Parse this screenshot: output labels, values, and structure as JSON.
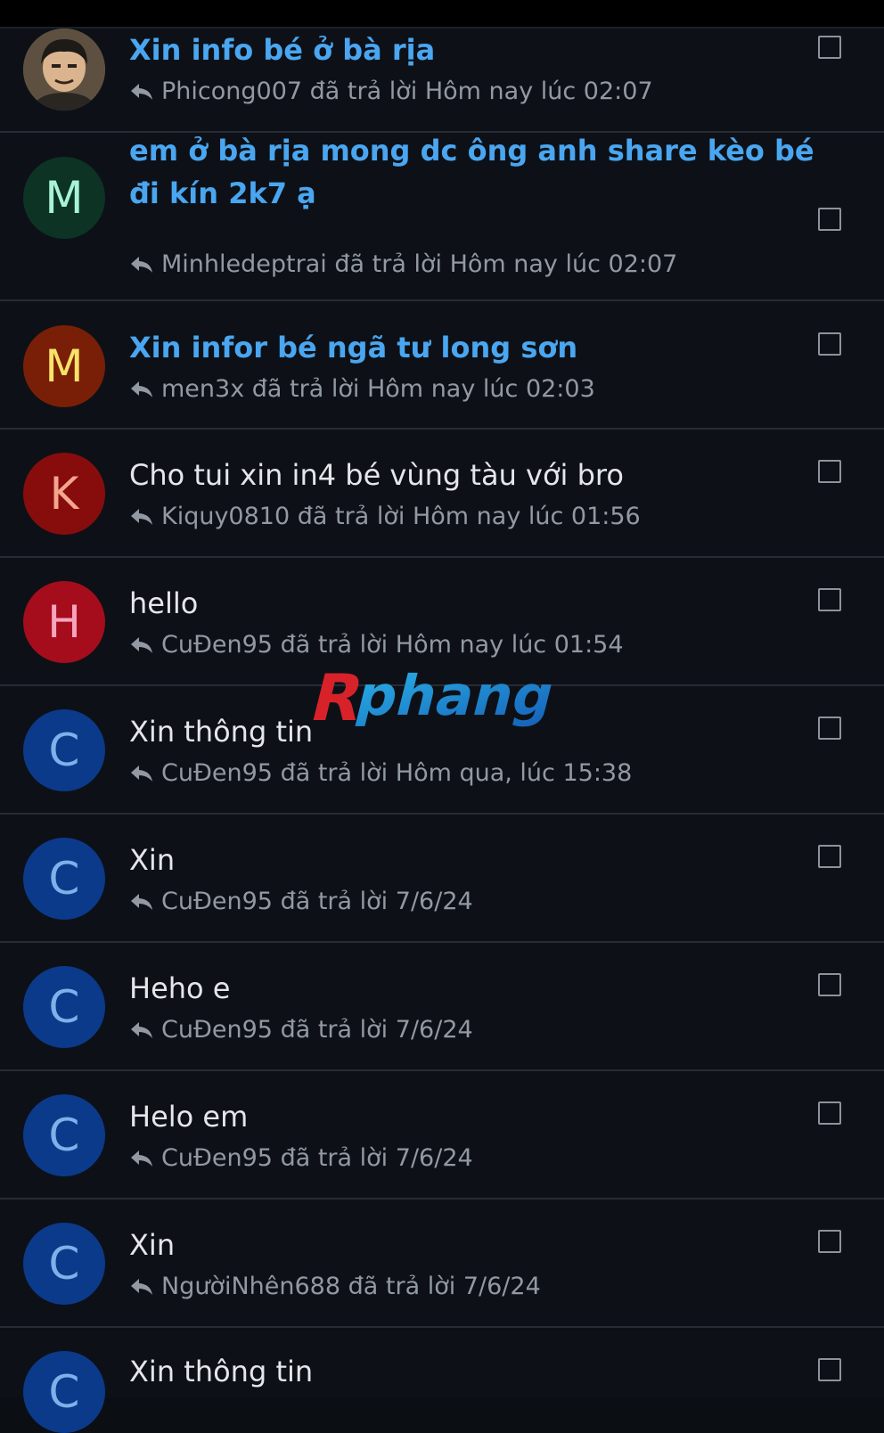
{
  "watermark": {
    "text_a": "R",
    "text_b": "phang"
  },
  "conversations": [
    {
      "title": "Xin info bé ở bà rịa",
      "unread": true,
      "avatar": {
        "type": "image",
        "letter": "",
        "bg": "#6b5a45",
        "fg": ""
      },
      "reply_user": "Phicong007",
      "reply_text": "đã trả lời",
      "reply_time": "Hôm nay lúc 02:07"
    },
    {
      "title": "em ở bà rịa mong dc ông anh share kèo bé đi kín 2k7 ạ",
      "unread": true,
      "avatar": {
        "type": "letter",
        "letter": "M",
        "bg": "#0d3324",
        "fg": "#a8f3d6"
      },
      "reply_user": "Minhledeptrai",
      "reply_text": "đã trả lời",
      "reply_time": "Hôm nay lúc 02:07"
    },
    {
      "title": "Xin infor bé ngã tư long sơn",
      "unread": true,
      "avatar": {
        "type": "letter",
        "letter": "M",
        "bg": "#7a1f07",
        "fg": "#f7e36a"
      },
      "reply_user": "men3x",
      "reply_text": "đã trả lời",
      "reply_time": "Hôm nay lúc 02:03"
    },
    {
      "title": "Cho tui xin in4 bé vùng tàu với bro",
      "unread": false,
      "avatar": {
        "type": "letter",
        "letter": "K",
        "bg": "#870d0d",
        "fg": "#f4a58e"
      },
      "reply_user": "Kiquy0810",
      "reply_text": "đã trả lời",
      "reply_time": "Hôm nay lúc 01:56"
    },
    {
      "title": "hello",
      "unread": false,
      "avatar": {
        "type": "letter",
        "letter": "H",
        "bg": "#a50d1c",
        "fg": "#f7a4bf"
      },
      "reply_user": "CuĐen95",
      "reply_text": "đã trả lời",
      "reply_time": "Hôm nay lúc 01:54"
    },
    {
      "title": "Xin thông tin",
      "unread": false,
      "avatar": {
        "type": "letter",
        "letter": "C",
        "bg": "#0b3a8a",
        "fg": "#7fb0ea"
      },
      "reply_user": "CuĐen95",
      "reply_text": "đã trả lời",
      "reply_time": "Hôm qua, lúc 15:38"
    },
    {
      "title": "Xin",
      "unread": false,
      "avatar": {
        "type": "letter",
        "letter": "C",
        "bg": "#0b3a8a",
        "fg": "#7fb0ea"
      },
      "reply_user": "CuĐen95",
      "reply_text": "đã trả lời",
      "reply_time": "7/6/24"
    },
    {
      "title": "Heho e",
      "unread": false,
      "avatar": {
        "type": "letter",
        "letter": "C",
        "bg": "#0b3a8a",
        "fg": "#7fb0ea"
      },
      "reply_user": "CuĐen95",
      "reply_text": "đã trả lời",
      "reply_time": "7/6/24"
    },
    {
      "title": "Helo em",
      "unread": false,
      "avatar": {
        "type": "letter",
        "letter": "C",
        "bg": "#0b3a8a",
        "fg": "#7fb0ea"
      },
      "reply_user": "CuĐen95",
      "reply_text": "đã trả lời",
      "reply_time": "7/6/24"
    },
    {
      "title": "Xin",
      "unread": false,
      "avatar": {
        "type": "letter",
        "letter": "C",
        "bg": "#0b3a8a",
        "fg": "#7fb0ea"
      },
      "reply_user": "NgườiNhên688",
      "reply_text": "đã trả lời",
      "reply_time": "7/6/24"
    },
    {
      "title": "Xin thông tin",
      "unread": false,
      "avatar": {
        "type": "letter",
        "letter": "C",
        "bg": "#0b3a8a",
        "fg": "#7fb0ea"
      },
      "reply_user": "",
      "reply_text": "",
      "reply_time": ""
    }
  ]
}
